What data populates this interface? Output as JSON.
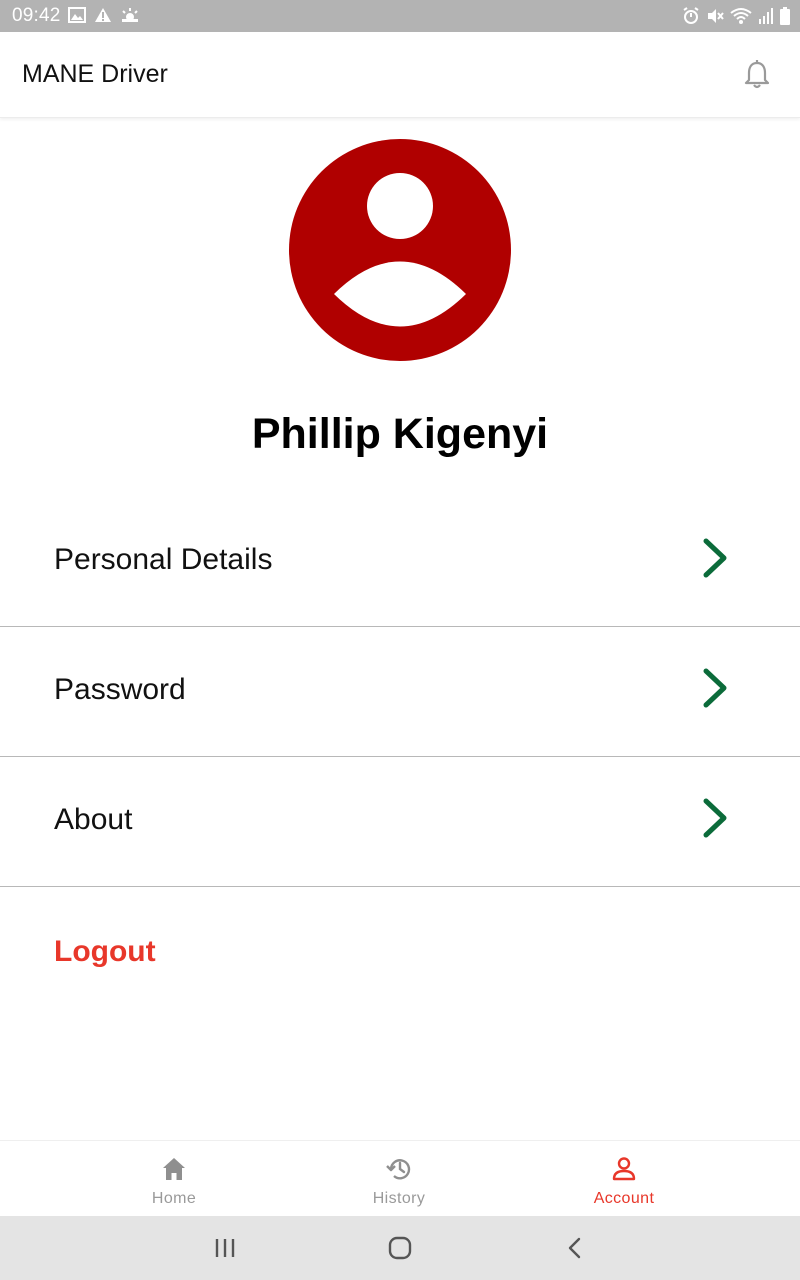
{
  "status_bar": {
    "time": "09:42",
    "left_icons": [
      "image-icon",
      "warning-icon",
      "weather-icon"
    ],
    "right_icons": [
      "alarm-icon",
      "mute-icon",
      "wifi-icon",
      "signal-icon",
      "battery-icon"
    ]
  },
  "app_bar": {
    "title": "MANE Driver",
    "action_icon": "bell-icon"
  },
  "profile": {
    "avatar_icon": "account-circle-icon",
    "name": "Phillip Kigenyi"
  },
  "menu": {
    "items": [
      {
        "label": "Personal Details",
        "icon": "chevron-right-icon"
      },
      {
        "label": "Password",
        "icon": "chevron-right-icon"
      },
      {
        "label": "About",
        "icon": "chevron-right-icon"
      }
    ],
    "logout_label": "Logout"
  },
  "bottom_nav": {
    "items": [
      {
        "label": "Home",
        "icon": "home-icon",
        "active": false
      },
      {
        "label": "History",
        "icon": "history-icon",
        "active": false
      },
      {
        "label": "Account",
        "icon": "person-icon",
        "active": true
      }
    ]
  },
  "system_nav": {
    "buttons": [
      "recents-icon",
      "home-circle-icon",
      "back-icon"
    ]
  },
  "colors": {
    "avatar_red": "#b00000",
    "chevron_green": "#0b6b3a",
    "logout_red": "#e8372a",
    "active_tab": "#e8372a",
    "inactive_tab": "#9a9a9a",
    "status_bar": "#b3b3b3",
    "system_nav": "#e4e4e4"
  }
}
